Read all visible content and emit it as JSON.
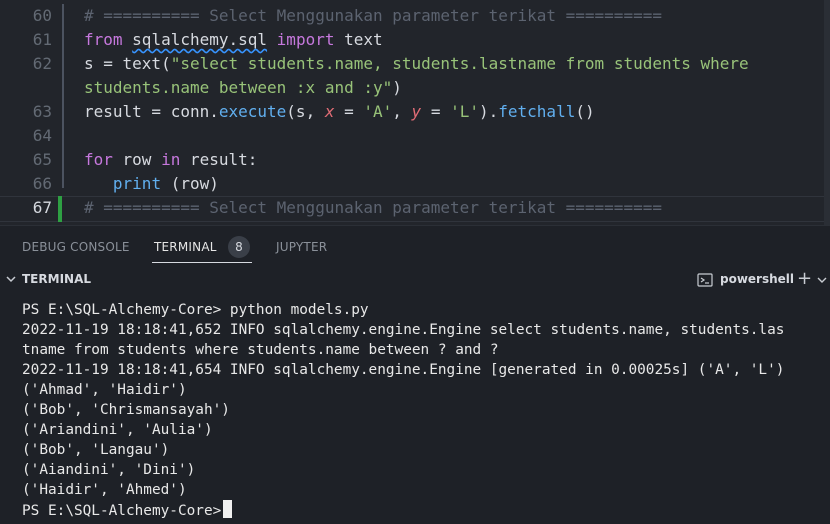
{
  "editor": {
    "lines": [
      {
        "num": "60",
        "segments": [
          {
            "t": "# ========== Select Menggunakan parameter terikat ==========",
            "c": "cm"
          }
        ]
      },
      {
        "num": "61",
        "segments": [
          {
            "t": "from",
            "c": "kw"
          },
          {
            "t": " ",
            "c": ""
          },
          {
            "t": "sqlalchemy.sql",
            "c": "mod"
          },
          {
            "t": " ",
            "c": ""
          },
          {
            "t": "import",
            "c": "kw"
          },
          {
            "t": " text",
            "c": ""
          }
        ]
      },
      {
        "num": "62",
        "segments": [
          {
            "t": "s = text(",
            "c": ""
          },
          {
            "t": "\"select students.name, students.lastname from students where",
            "c": "st"
          }
        ]
      },
      {
        "num": "",
        "segments": [
          {
            "t": "students.name between :x and :y\"",
            "c": "st"
          },
          {
            "t": ")",
            "c": ""
          }
        ]
      },
      {
        "num": "63",
        "segments": [
          {
            "t": "result = conn.",
            "c": ""
          },
          {
            "t": "execute",
            "c": "fn"
          },
          {
            "t": "(s, ",
            "c": ""
          },
          {
            "t": "x",
            "c": "pm"
          },
          {
            "t": " = ",
            "c": ""
          },
          {
            "t": "'A'",
            "c": "st"
          },
          {
            "t": ", ",
            "c": ""
          },
          {
            "t": "y",
            "c": "pm"
          },
          {
            "t": " = ",
            "c": ""
          },
          {
            "t": "'L'",
            "c": "st"
          },
          {
            "t": ").",
            "c": ""
          },
          {
            "t": "fetchall",
            "c": "fn"
          },
          {
            "t": "()",
            "c": ""
          }
        ]
      },
      {
        "num": "64",
        "segments": []
      },
      {
        "num": "65",
        "segments": [
          {
            "t": "for",
            "c": "kw"
          },
          {
            "t": " row ",
            "c": ""
          },
          {
            "t": "in",
            "c": "kw"
          },
          {
            "t": " result:",
            "c": ""
          }
        ]
      },
      {
        "num": "66",
        "segments": [
          {
            "t": "   ",
            "c": ""
          },
          {
            "t": "print",
            "c": "fn"
          },
          {
            "t": " (row)",
            "c": ""
          }
        ]
      },
      {
        "num": "67",
        "segments": [
          {
            "t": "# ========== Select Menggunakan parameter terikat ==========",
            "c": "cm"
          }
        ]
      }
    ]
  },
  "panel": {
    "tabs": [
      {
        "label": "DEBUG CONSOLE",
        "active": false
      },
      {
        "label": "TERMINAL",
        "active": true
      },
      {
        "label": "JUPYTER",
        "active": false
      }
    ],
    "terminal_badge": "8"
  },
  "terminal_header": {
    "title": "TERMINAL",
    "shell": "powershell",
    "add": "+"
  },
  "terminal": {
    "lines": [
      "PS E:\\SQL-Alchemy-Core> python models.py",
      "2022-11-19 18:18:41,652 INFO sqlalchemy.engine.Engine select students.name, students.las",
      "tname from students where students.name between ? and ?",
      "2022-11-19 18:18:41,654 INFO sqlalchemy.engine.Engine [generated in 0.00025s] ('A', 'L')",
      "('Ahmad', 'Haidir')",
      "('Bob', 'Chrismansayah')",
      "('Ariandini', 'Aulia')",
      "('Bob', 'Langau')",
      "('Aiandini', 'Dini')",
      "('Haidir', 'Ahmed')",
      "PS E:\\SQL-Alchemy-Core>"
    ]
  }
}
